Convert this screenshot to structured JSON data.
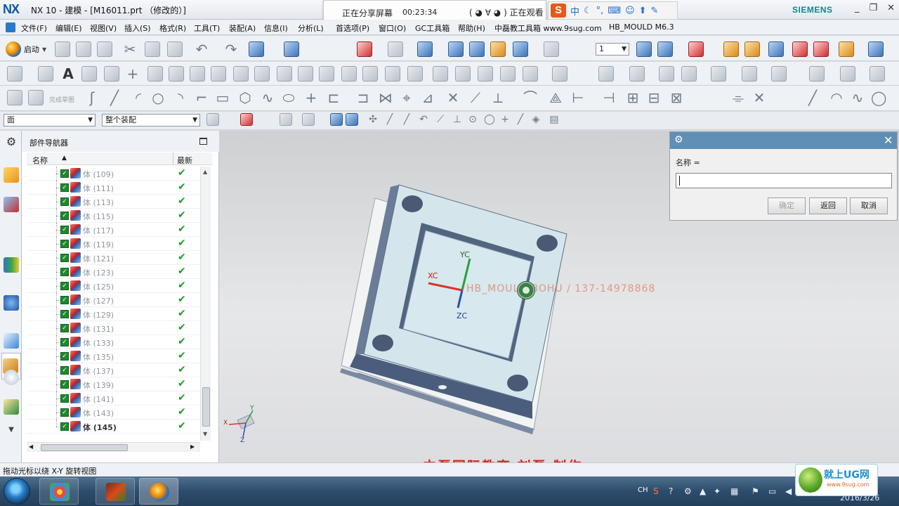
{
  "window": {
    "app_logo": "NX",
    "title": "NX 10 - 建模 - [M16011.prt （修改的）]",
    "brand": "SIEMENS",
    "controls": [
      "_",
      "□",
      "✕"
    ]
  },
  "screen_share": {
    "status": "正在分享屏幕",
    "elapsed": "00:23:34",
    "viewer_status": "( ◕ ∀ ◕ ) 正在观看"
  },
  "ime": {
    "logo": "S",
    "mode": "中"
  },
  "menubar": {
    "items": [
      "文件(F)",
      "编辑(E)",
      "视图(V)",
      "插入(S)",
      "格式(R)",
      "工具(T)",
      "装配(A)",
      "信息(I)",
      "分析(L)",
      "首选项(P)",
      "窗口(O)",
      "GC工具箱",
      "帮助(H)",
      "中磊教工具箱 www.9sug.com",
      "HB_MOULD M6.3"
    ]
  },
  "toolbar": {
    "start_label": "启动",
    "sketch_label": "完成草图",
    "layer_value": "1",
    "type_filter": "面",
    "scope_filter": "整个装配"
  },
  "navigator": {
    "title": "部件导航器",
    "col_name": "名称",
    "col_latest": "最新",
    "rows": [
      {
        "name": "体 (109)",
        "latest": "✔"
      },
      {
        "name": "体 (111)",
        "latest": "✔"
      },
      {
        "name": "体 (113)",
        "latest": "✔"
      },
      {
        "name": "体 (115)",
        "latest": "✔"
      },
      {
        "name": "体 (117)",
        "latest": "✔"
      },
      {
        "name": "体 (119)",
        "latest": "✔"
      },
      {
        "name": "体 (121)",
        "latest": "✔"
      },
      {
        "name": "体 (123)",
        "latest": "✔"
      },
      {
        "name": "体 (125)",
        "latest": "✔"
      },
      {
        "name": "体 (127)",
        "latest": "✔"
      },
      {
        "name": "体 (129)",
        "latest": "✔"
      },
      {
        "name": "体 (131)",
        "latest": "✔"
      },
      {
        "name": "体 (133)",
        "latest": "✔"
      },
      {
        "name": "体 (135)",
        "latest": "✔"
      },
      {
        "name": "体 (137)",
        "latest": "✔"
      },
      {
        "name": "体 (139)",
        "latest": "✔"
      },
      {
        "name": "体 (141)",
        "latest": "✔"
      },
      {
        "name": "体 (143)",
        "latest": "✔"
      },
      {
        "name": "体 (145)",
        "latest": "✔"
      }
    ]
  },
  "graphics": {
    "axis_yc": "YC",
    "axis_xc": "XC",
    "axis_zc": "ZC",
    "watermark": "HB_MOULD     BOHU  /  137-14978868",
    "triad_x": "X",
    "triad_y": "Y",
    "triad_z": "Z",
    "caption": "中磊国际教育  刘磊  制作"
  },
  "dialog": {
    "name_label": "名称   =",
    "name_value": "",
    "ok_label": "确定",
    "back_label": "返回",
    "cancel_label": "取消"
  },
  "statusbar": {
    "message": "拖动光标以绕 X-Y 旋转视图"
  },
  "taskbar": {
    "tray_lang": "CH",
    "date": "2016/3/26"
  },
  "watermark_brand": {
    "name": "就上UG网",
    "url": "www.9sug.com"
  },
  "colors": {
    "dialog_header": "#5f8fb5",
    "checkmark": "#1c9a2c",
    "caption": "#d8201a",
    "part_face": "#d4e6ec",
    "part_side": "#4a5f7f"
  }
}
